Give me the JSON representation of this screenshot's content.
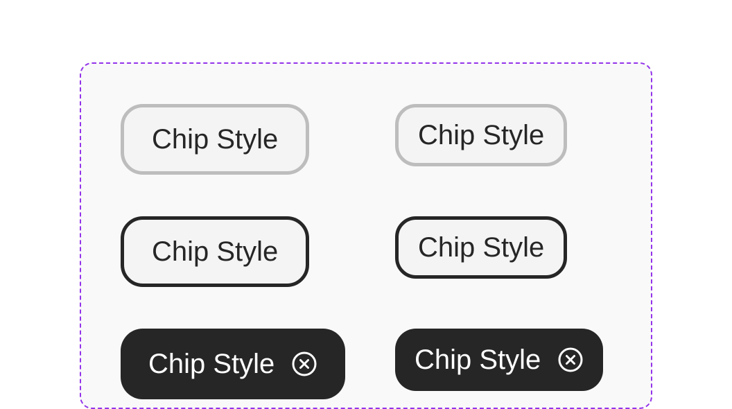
{
  "chips": {
    "outline_light_large": {
      "label": "Chip Style"
    },
    "outline_light_small": {
      "label": "Chip Style"
    },
    "outline_dark_large": {
      "label": "Chip Style"
    },
    "outline_dark_small": {
      "label": "Chip Style"
    },
    "filled_large": {
      "label": "Chip Style",
      "icon": "close-circle-icon"
    },
    "filled_small": {
      "label": "Chip Style",
      "icon": "close-circle-icon"
    }
  },
  "colors": {
    "frame_border": "#9333ea",
    "frame_background": "#f9f9f9",
    "chip_dark": "#262626",
    "chip_light_border": "#bdbdbd",
    "chip_surface": "#f4f4f4"
  }
}
